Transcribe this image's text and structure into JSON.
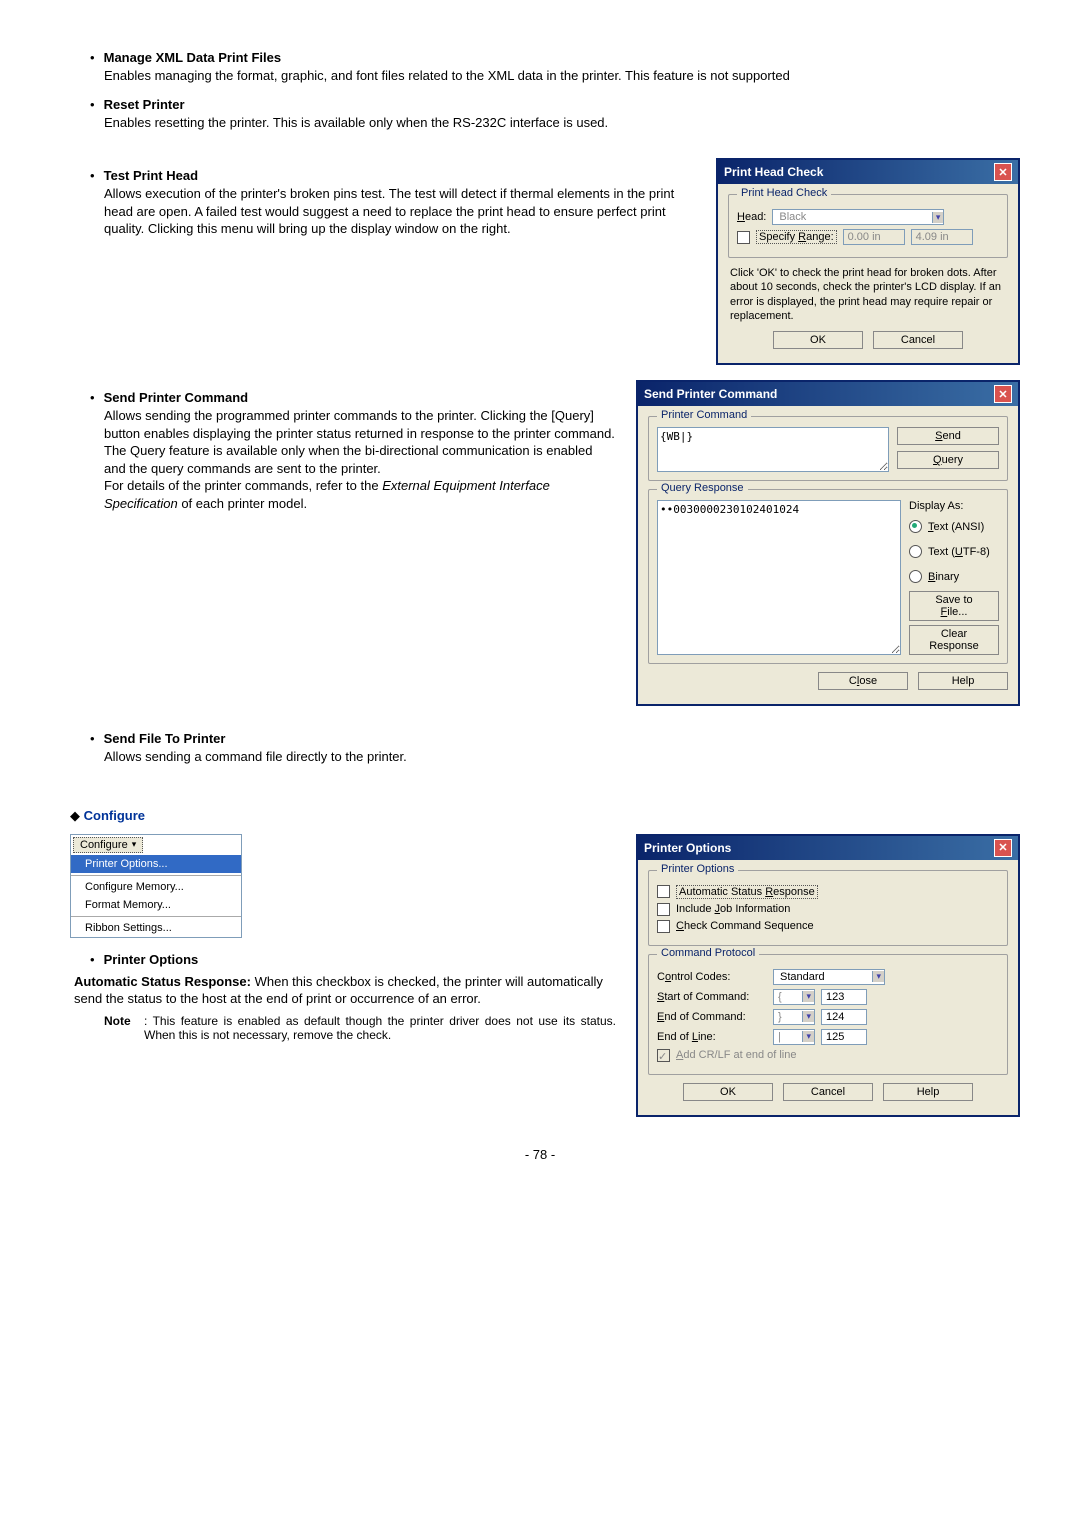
{
  "items": {
    "manage_xml": {
      "title": "Manage XML Data Print Files",
      "body": "Enables managing the format, graphic, and font files related to the XML data in the printer.    This feature is not supported"
    },
    "reset_printer": {
      "title": "Reset Printer",
      "body": "Enables resetting the printer.    This is available only when the RS-232C interface is used."
    },
    "test_head": {
      "title": "Test Print Head",
      "body": "Allows execution of the printer's broken pins test. The test will detect if thermal elements in the print head are open.  A failed test would suggest a need to replace the print head to ensure perfect print quality.    Clicking this menu will bring up the display window on the right."
    },
    "send_cmd": {
      "title": "Send Printer Command",
      "body1": "Allows sending the programmed printer commands to the printer.    Clicking the [Query] button enables displaying the printer status returned in response to the printer command.  The Query feature is available only when the bi-directional communication is enabled and the query commands are sent to the printer.",
      "body2_pre": "For details of the printer commands, refer to the ",
      "body2_em": "External Equipment Interface Specification",
      "body2_post": " of each printer model."
    },
    "send_file": {
      "title": "Send File To Printer",
      "body": "Allows sending a command file directly to the printer."
    },
    "configure_header": "Configure",
    "printer_options": {
      "title": "Printer Options",
      "asr_label": "Automatic Status Response:",
      "asr_body": "    When this checkbox is checked, the printer will automatically send the status to the host at the end of print or occurrence of an error.",
      "note_label": "Note",
      "note_body": ": This feature is enabled as default though the printer driver does not use its status.  When this is not necessary, remove the check."
    }
  },
  "dlg_head": {
    "title": "Print Head Check",
    "group": "Print Head Check",
    "head_label": "Head:",
    "head_value": "Black",
    "specify_range": "Specify Range:",
    "range_from": "0.00 in",
    "range_to": "4.09 in",
    "desc": "Click 'OK' to check the print head for broken dots.  After about 10 seconds, check the printer's LCD display.  If an error is displayed, the print head may require repair or replacement.",
    "ok": "OK",
    "cancel": "Cancel"
  },
  "dlg_send": {
    "title": "Send Printer Command",
    "group_cmd": "Printer Command",
    "cmd_text": "{WB|}",
    "send": "Send",
    "query": "Query",
    "group_resp": "Query Response",
    "resp_text": "••0030000230102401024",
    "display_as": "Display As:",
    "r_ansi": "Text (ANSI)",
    "r_utf8": "Text (UTF-8)",
    "r_binary": "Binary",
    "save": "Save to File...",
    "clear": "Clear Response",
    "close": "Close",
    "help": "Help"
  },
  "menu": {
    "header": "Configure",
    "m1": "Printer Options...",
    "m2": "Configure Memory...",
    "m3": "Format Memory...",
    "m4": "Ribbon Settings..."
  },
  "dlg_opts": {
    "title": "Printer Options",
    "group1": "Printer Options",
    "c1": "Automatic Status Response",
    "c2": "Include Job Information",
    "c3": "Check Command Sequence",
    "group2": "Command Protocol",
    "control_codes": "Control Codes:",
    "control_codes_v": "Standard",
    "start": "Start of Command:",
    "start_ch": "{",
    "start_v": "123",
    "end": "End of Command:",
    "end_ch": "}",
    "end_v": "124",
    "eol": "End of Line:",
    "eol_ch": "|",
    "eol_v": "125",
    "crlf": "Add CR/LF at end of line",
    "ok": "OK",
    "cancel": "Cancel",
    "help": "Help"
  },
  "page_num": "- 78 -"
}
